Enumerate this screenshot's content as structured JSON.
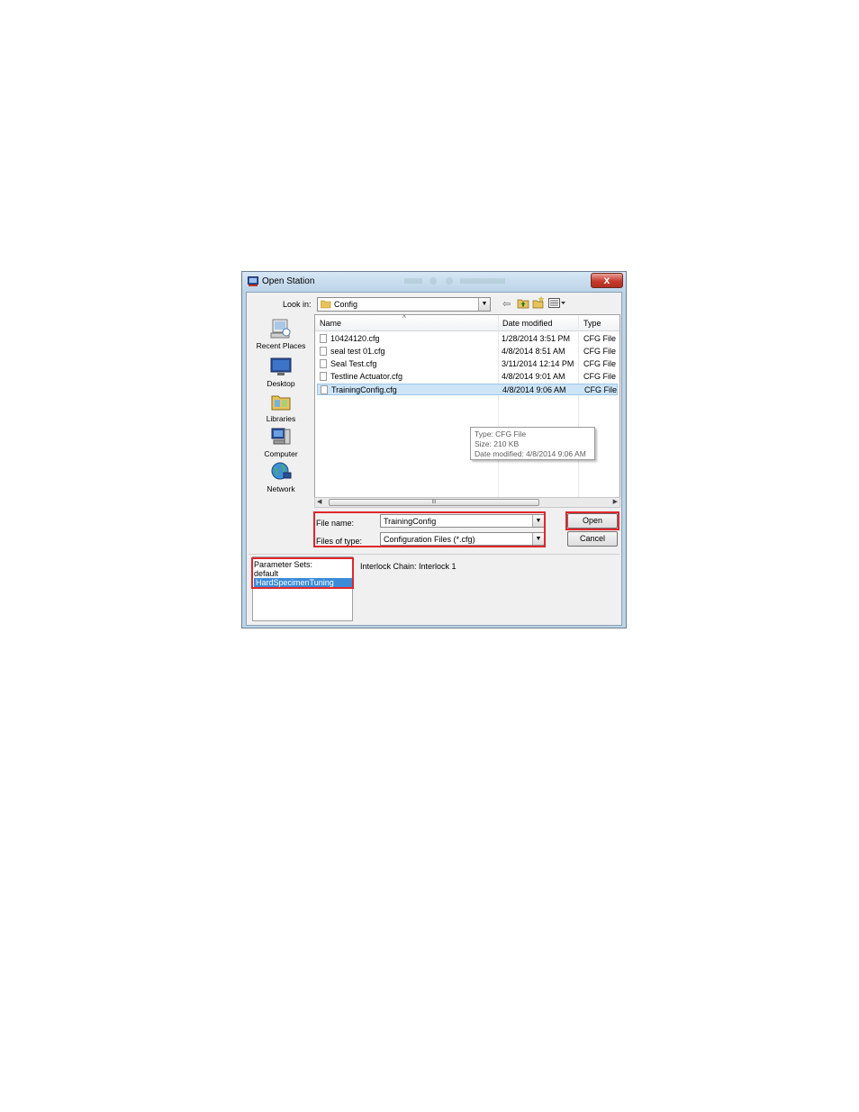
{
  "window": {
    "title": "Open Station",
    "close_label": "x"
  },
  "lookin": {
    "label": "Look in:",
    "value": "Config"
  },
  "places": [
    {
      "label": "Recent Places",
      "icon": "recent-places-icon"
    },
    {
      "label": "Desktop",
      "icon": "desktop-icon"
    },
    {
      "label": "Libraries",
      "icon": "libraries-icon"
    },
    {
      "label": "Computer",
      "icon": "computer-icon"
    },
    {
      "label": "Network",
      "icon": "network-icon"
    }
  ],
  "columns": {
    "name": "Name",
    "date": "Date modified",
    "type": "Type"
  },
  "files": [
    {
      "name": "10424120.cfg",
      "date": "1/28/2014 3:51 PM",
      "type": "CFG File"
    },
    {
      "name": "seal test 01.cfg",
      "date": "4/8/2014 8:51 AM",
      "type": "CFG File"
    },
    {
      "name": "Seal Test.cfg",
      "date": "3/11/2014 12:14 PM",
      "type": "CFG File"
    },
    {
      "name": "Testline Actuator.cfg",
      "date": "4/8/2014 9:01 AM",
      "type": "CFG File"
    },
    {
      "name": "TrainingConfig.cfg",
      "date": "4/8/2014 9:06 AM",
      "type": "CFG File",
      "selected": true
    }
  ],
  "tooltip": {
    "type": "Type: CFG File",
    "size": "Size: 210 KB",
    "date": "Date modified: 4/8/2014 9:06 AM"
  },
  "scrollbar": {
    "grip": "III"
  },
  "filename": {
    "label": "File name:",
    "value": "TrainingConfig"
  },
  "filetype": {
    "label": "Files of type:",
    "value": "Configuration Files (*.cfg)"
  },
  "buttons": {
    "open": "Open",
    "cancel": "Cancel"
  },
  "parameter_sets": {
    "label": "Parameter Sets:",
    "items": [
      "default",
      "HardSpecimenTuning"
    ],
    "selected": "HardSpecimenTuning"
  },
  "interlock": "Interlock Chain: Interlock 1",
  "colors": {
    "highlight_box": "#e0262b",
    "selection": "#3b8bd8",
    "row_selection": "#cde4f7"
  }
}
